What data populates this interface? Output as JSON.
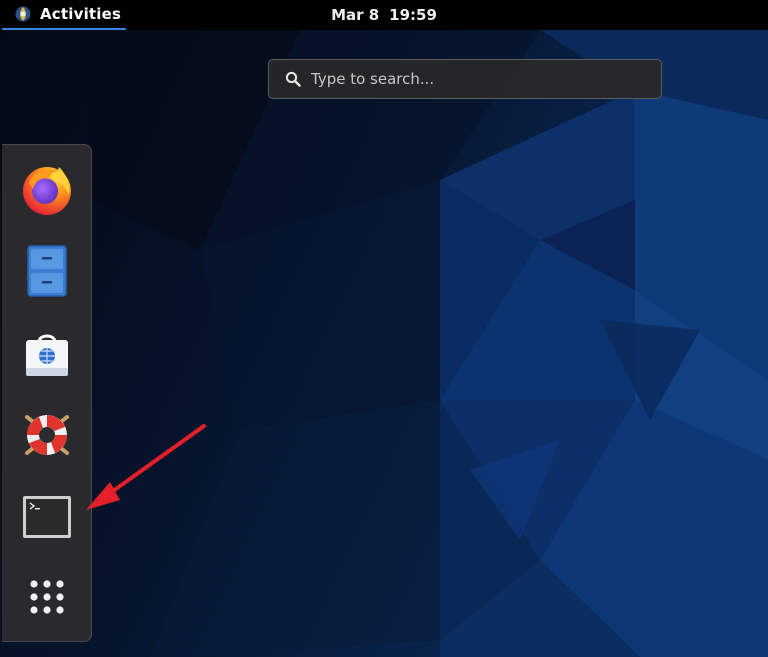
{
  "topbar": {
    "activities_label": "Activities",
    "clock_date": "Mar 8",
    "clock_time": "19:59"
  },
  "search": {
    "placeholder": "Type to search..."
  },
  "dock": {
    "items": [
      {
        "name": "firefox",
        "icon": "firefox-icon"
      },
      {
        "name": "files",
        "icon": "file-cabinet-icon"
      },
      {
        "name": "software",
        "icon": "shopping-bag-icon"
      },
      {
        "name": "help",
        "icon": "lifebuoy-icon"
      },
      {
        "name": "terminal",
        "icon": "terminal-icon"
      },
      {
        "name": "show-applications",
        "icon": "app-grid-icon"
      }
    ]
  },
  "annotation": {
    "arrow_color": "#e5202a",
    "target": "terminal"
  },
  "colors": {
    "accent": "#3584e4",
    "topbar_bg": "#000000",
    "dock_bg": "#2c2c2e"
  }
}
